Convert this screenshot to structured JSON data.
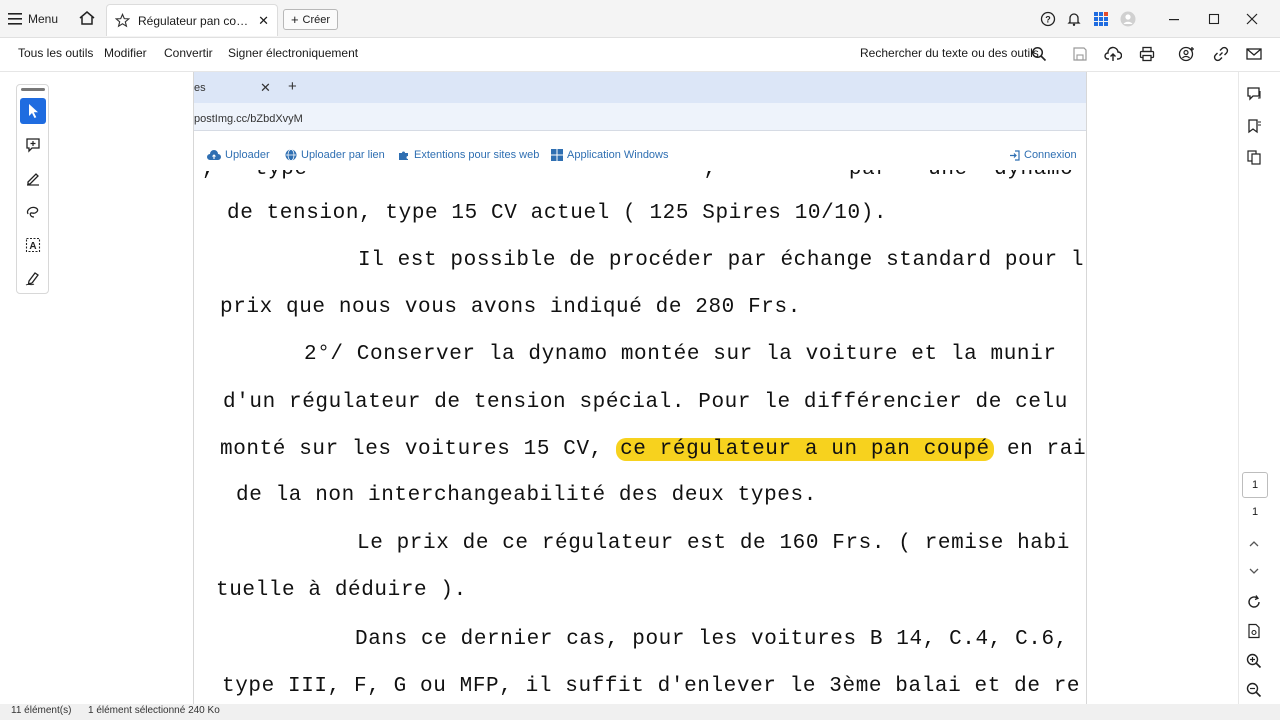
{
  "titlebar": {
    "menu_label": "Menu",
    "tab_title": "Régulateur pan coupé...",
    "create_label": "Créer"
  },
  "toolbar": {
    "items": [
      "Tous les outils",
      "Modifier",
      "Convertir",
      "Signer électroniquement"
    ],
    "search_label": "Rechercher du texte ou des outils"
  },
  "page_nav": {
    "current": "1",
    "total": "1"
  },
  "browser": {
    "tab_text": "es",
    "url": "postImg.cc/bZbdXvyM",
    "nav": [
      "Uploader",
      "Uploader par lien",
      "Extentions pour sites web",
      "Application Windows"
    ],
    "login": "Connexion"
  },
  "document": {
    "lines": [
      ",   type                              ,          par   une  dynamo  à  régula",
      "de tension, type 15 CV actuel ( 125 Spires 10/10).",
      "Il est possible de procéder par échange standard pour l",
      "prix que nous vous avons indiqué de 280 Frs.",
      "2°/ Conserver la dynamo montée sur la voiture et la munir",
      "d'un régulateur de tension spécial. Pour le différencier de celu",
      "monté sur les voitures 15 CV,",
      "ce régulateur a un pan coupé",
      "en rai",
      "de la non interchangeabilité des deux types.",
      "Le prix de ce régulateur est de 160 Frs. ( remise habi",
      "tuelle à déduire ).",
      "Dans ce dernier cas, pour les voitures B 14, C.4, C.6,",
      "type III, F, G ou MFP, il suffit d'enlever le 3ème balai et de re"
    ]
  },
  "statusbar": {
    "count": "11 élément(s)",
    "selected": "1 élément sélectionné  240 Ko"
  }
}
